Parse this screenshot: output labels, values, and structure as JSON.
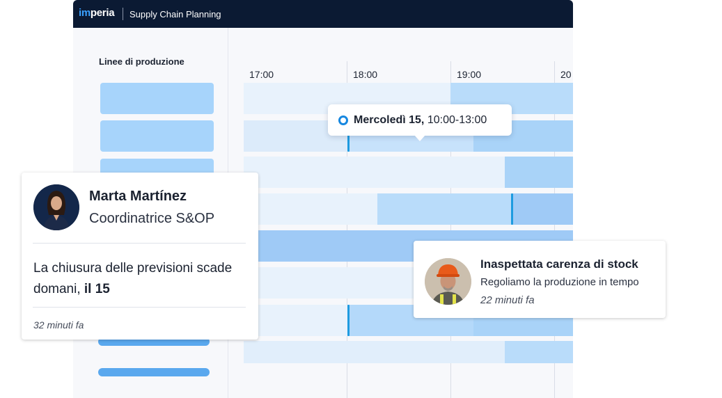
{
  "app": {
    "logo_prefix": "im",
    "logo_rest": "peria",
    "title": "Supply Chain Planning"
  },
  "left_panel": {
    "title": "Linee di produzione"
  },
  "timeline": {
    "hours": [
      "17:00",
      "18:00",
      "19:00",
      "20"
    ]
  },
  "tooltip": {
    "date": "Mercoledì 15,",
    "time_range": "10:00-13:00"
  },
  "notification_1": {
    "name": "Marta Martínez",
    "role": "Coordinatrice S&OP",
    "message_start": "La chiusura delle previsioni scade domani,",
    "message_bold": "il 15",
    "time": "32 minuti fa"
  },
  "notification_2": {
    "title": "Inaspettata carenza di stock",
    "subtitle": "Regoliamo la produzione in tempo",
    "time": "22 minuti fa"
  },
  "colors": {
    "topbar": "#0b1a33",
    "accent": "#1e9be0",
    "bar_light": "#cfe5fb",
    "bar_medium": "#a7d4fb",
    "bar_strong": "#8fc4f5"
  }
}
